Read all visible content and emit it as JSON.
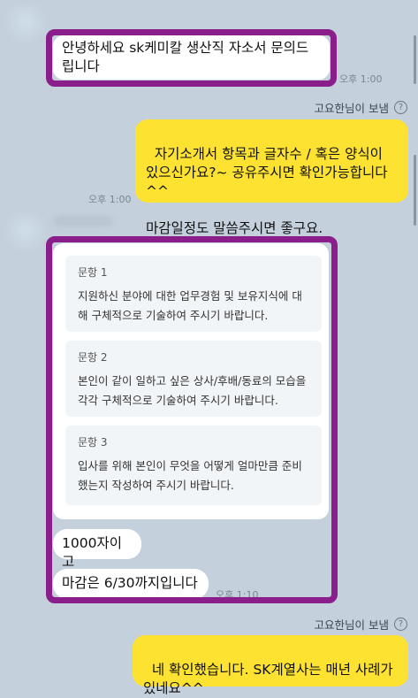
{
  "chat": {
    "messages": [
      {
        "id": "m1",
        "text": "안녕하세요 sk케미칼 생산직 자소서 문의드립니다",
        "time": "오후 1:00"
      },
      {
        "id": "m2",
        "sender": "고요한님이 보냄",
        "text": "자기소개서 항목과 글자수 / 혹은 양식이 있으신가요?~ 공유주시면 확인가능합니다^^\n\n마감일정도 말씀주시면 좋구요.",
        "time": "오후 1:00"
      },
      {
        "id": "m3",
        "questions": [
          {
            "title": "문항 1",
            "body": "지원하신 분야에 대한 업무경험 및 보유지식에 대해 구체적으로 기술하여 주시기 바랍니다."
          },
          {
            "title": "문항 2",
            "body": "본인이 같이 일하고 싶은 상사/후배/동료의 모습을 각각 구체적으로 기술하여 주시기 바랍니다."
          },
          {
            "title": "문항 3",
            "body": "입사를 위해 본인이 무엇을 어떻게 얼마만큼 준비했는지 작성하여 주시기 바랍니다."
          }
        ]
      },
      {
        "id": "m4",
        "text": "1000자이고"
      },
      {
        "id": "m5",
        "text": "마감은 6/30까지입니다",
        "time": "오후 1:10"
      },
      {
        "id": "m6",
        "sender": "고요한님이 보냄",
        "text": "네 확인했습니다. SK계열사는 매년 사례가 있네요^^"
      }
    ],
    "help_symbol": "?"
  },
  "colors": {
    "background": "#c4d0dc",
    "my_bubble": "#fde231",
    "their_bubble": "#ffffff",
    "highlight": "#8a1f8c"
  }
}
